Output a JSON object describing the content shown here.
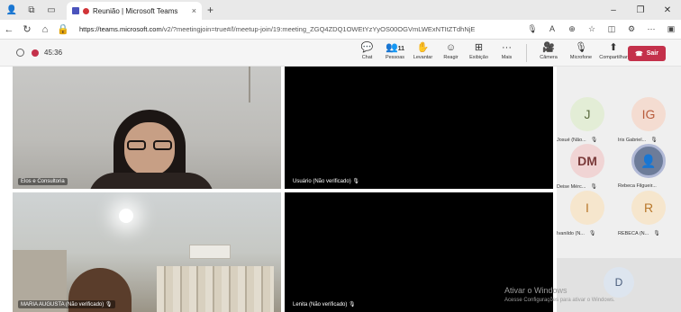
{
  "browser": {
    "tab_title": "Reunião | Microsoft Teams",
    "tab_close": "×",
    "new_tab": "+",
    "url_host": "https://teams.microsoft.com",
    "url_path": "/v2/?meetingjoin=true#/l/meetup-join/19:meeting_ZGQ4ZDQ1OWEtYzYyOS00OGVmLWExNTItZTdhNjE..."
  },
  "teams": {
    "timer": "45:36",
    "toolbar": [
      {
        "icon": "chat-icon",
        "glyph": "💬",
        "label": "Chat"
      },
      {
        "icon": "people-icon",
        "glyph": "👥",
        "label": "Pessoas",
        "count": "11"
      },
      {
        "icon": "raise-hand-icon",
        "glyph": "✋",
        "label": "Levantar"
      },
      {
        "icon": "react-icon",
        "glyph": "☺",
        "label": "Reagir"
      },
      {
        "icon": "view-icon",
        "glyph": "⊞",
        "label": "Exibição"
      },
      {
        "icon": "more-icon",
        "glyph": "···",
        "label": "Mais"
      }
    ],
    "camera_label": "Câmera",
    "mic_label": "Microfone",
    "share_label": "Compartilhar",
    "leave_label": "Sair"
  },
  "tiles": [
    {
      "name": "Elos e Consultoria"
    },
    {
      "name": "Usuário (Não verificado)"
    },
    {
      "name": "MARIA AUGUSTA (Não verificado)"
    },
    {
      "name": "Lenita (Não verificado)"
    }
  ],
  "participants": [
    {
      "initials": "J",
      "label": "Josué (Não..."
    },
    {
      "initials": "IG",
      "label": "Iris Gabriel..."
    },
    {
      "initials": "DM",
      "label": "Deise Mérc..."
    },
    {
      "initials": "",
      "label": "Rebeca Filgueir..."
    },
    {
      "initials": "I",
      "label": "Ivanildo (N..."
    },
    {
      "initials": "R",
      "label": "REBECA (N..."
    },
    {
      "initials": "D",
      "label": ""
    }
  ],
  "watermark": {
    "line1": "Ativar o Windows",
    "line2": "Acesse Configurações para ativar o Windows."
  }
}
